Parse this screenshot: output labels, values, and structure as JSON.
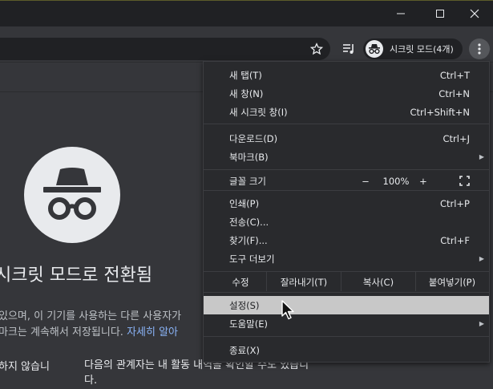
{
  "window": {
    "minimize_icon": "minimize-icon",
    "maximize_icon": "maximize-icon",
    "close_icon": "close-icon"
  },
  "toolbar": {
    "incognito_label": "시크릿 모드(4개)"
  },
  "page": {
    "heading": "시크릿 모드로 전환됨",
    "line1": "있으며, 이 기기를 사용하는 다른 사용자가",
    "line2_text": "마크는 계속해서 저장됩니다. ",
    "line2_link": "자세히 알아",
    "left_col": "하지 않습니",
    "right_col": "다음의 관계자는 내 활동 내역을 확인할 수도 있습니다."
  },
  "menu": {
    "new_tab": {
      "label": "새 탭(T)",
      "shortcut": "Ctrl+T"
    },
    "new_window": {
      "label": "새 창(N)",
      "shortcut": "Ctrl+N"
    },
    "new_incognito": {
      "label": "새 시크릿 창(I)",
      "shortcut": "Ctrl+Shift+N"
    },
    "downloads": {
      "label": "다운로드(D)",
      "shortcut": "Ctrl+J"
    },
    "bookmarks": {
      "label": "북마크(B)"
    },
    "font_size": {
      "label": "글꼴 크기",
      "minus": "−",
      "value": "100%",
      "plus": "+"
    },
    "print": {
      "label": "인쇄(P)",
      "shortcut": "Ctrl+P"
    },
    "cast": {
      "label": "전송(C)..."
    },
    "find": {
      "label": "찾기(F)...",
      "shortcut": "Ctrl+F"
    },
    "more_tools": {
      "label": "도구 더보기"
    },
    "edit": {
      "label": "수정",
      "cut": "잘라내기(T)",
      "copy": "복사(C)",
      "paste": "붙여넣기(P)"
    },
    "settings": {
      "label": "설정(S)"
    },
    "help": {
      "label": "도움말(E)"
    },
    "exit": {
      "label": "종료(X)"
    }
  }
}
